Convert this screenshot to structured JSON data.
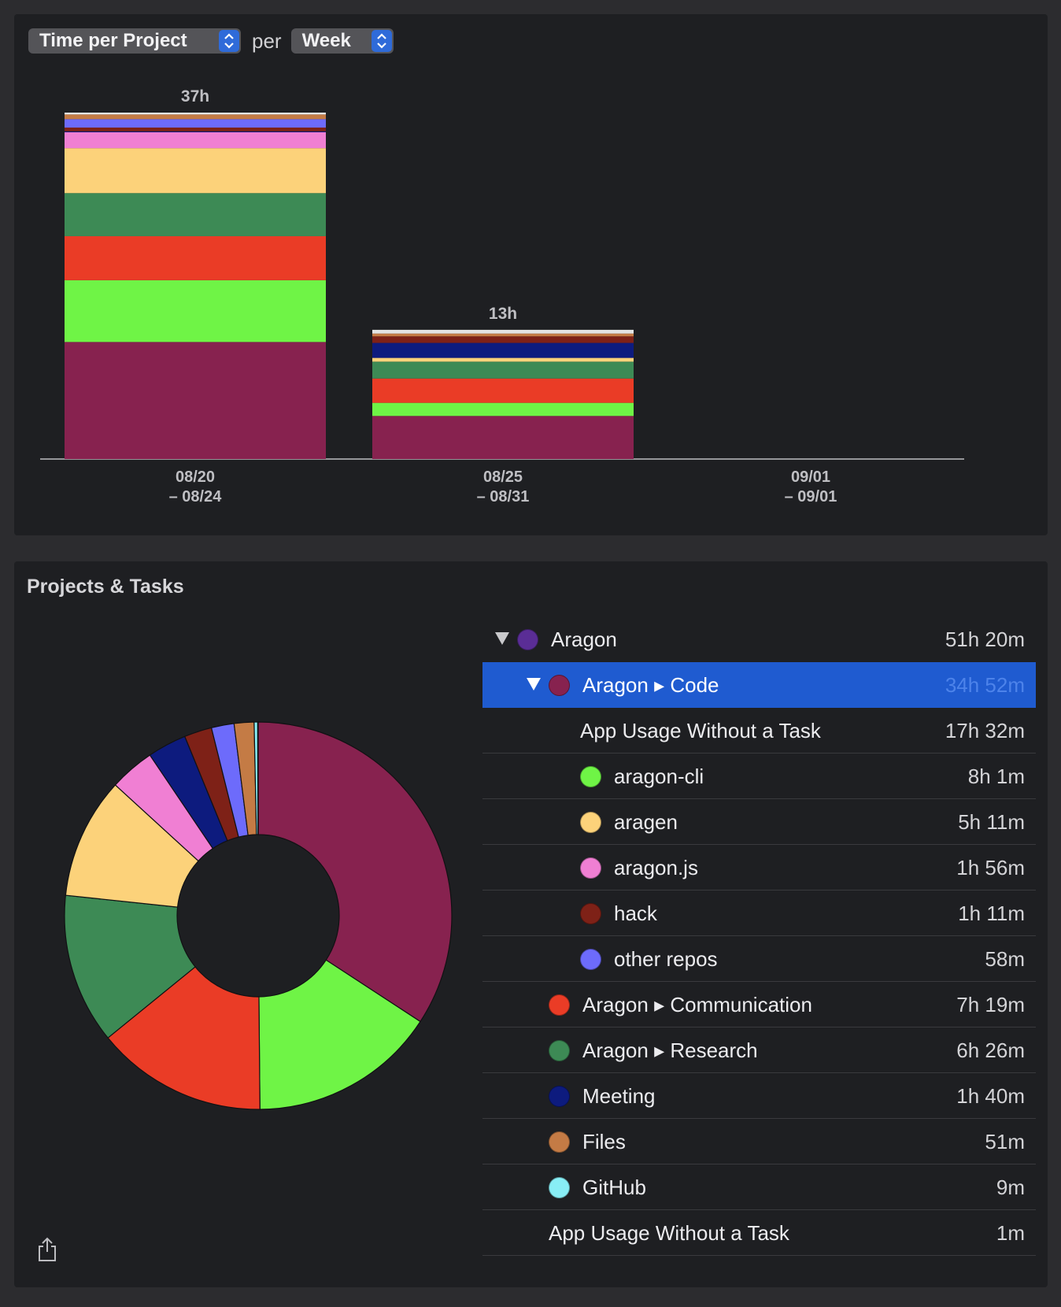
{
  "toolbar": {
    "metric_select": "Time per Project",
    "per_label": "per",
    "period_select": "Week"
  },
  "colors": {
    "code": "#87224f",
    "cli": "#6ff446",
    "communication": "#ea3c26",
    "research": "#3d8a55",
    "aragen": "#fcd27a",
    "aragonjs": "#f07fd3",
    "hack": "#7e2117",
    "other_repos": "#6d6bfb",
    "meeting": "#0d1b7e",
    "files": "#c47b45",
    "github": "#88eef5",
    "no_task": "#e4e4e4",
    "aragon": "#5a2d96"
  },
  "chart_data": [
    {
      "type": "bar",
      "stacked": true,
      "categories": [
        "08/20 – 08/24",
        "08/25 – 08/31",
        "09/01 – 09/01"
      ],
      "category_lines": [
        [
          "08/20",
          "– 08/24"
        ],
        [
          "08/25",
          "– 08/31"
        ],
        [
          "09/01",
          "– 09/01"
        ]
      ],
      "totals": [
        "37h",
        "13h",
        ""
      ],
      "total_hours": [
        37,
        13,
        0
      ],
      "unit": "hours",
      "ylim": [
        0,
        37
      ],
      "grid": false,
      "series": [
        {
          "color": "#87224f",
          "values": [
            12.5,
            4.6,
            0
          ]
        },
        {
          "color": "#6ff446",
          "values": [
            6.6,
            1.4,
            0
          ]
        },
        {
          "color": "#ea3c26",
          "values": [
            4.7,
            2.6,
            0
          ]
        },
        {
          "color": "#3d8a55",
          "values": [
            4.6,
            1.8,
            0
          ]
        },
        {
          "color": "#fcd27a",
          "values": [
            4.8,
            0.4,
            0
          ]
        },
        {
          "color": "#f07fd3",
          "values": [
            1.7,
            0.0,
            0
          ]
        },
        {
          "color": "#0d1b7e",
          "values": [
            0.1,
            1.6,
            0
          ]
        },
        {
          "color": "#7e2117",
          "values": [
            0.4,
            0.7,
            0
          ]
        },
        {
          "color": "#6d6bfb",
          "values": [
            0.9,
            0.0,
            0
          ]
        },
        {
          "color": "#c47b45",
          "values": [
            0.5,
            0.3,
            0
          ]
        },
        {
          "color": "#e4e4e4",
          "values": [
            0.2,
            0.4,
            0
          ]
        }
      ]
    },
    {
      "type": "pie",
      "donut": true,
      "unit": "hours",
      "slices": [
        {
          "color": "#87224f",
          "value": 17.53
        },
        {
          "color": "#6ff446",
          "value": 8.02
        },
        {
          "color": "#ea3c26",
          "value": 7.32
        },
        {
          "color": "#3d8a55",
          "value": 6.43
        },
        {
          "color": "#fcd27a",
          "value": 5.18
        },
        {
          "color": "#f07fd3",
          "value": 1.93
        },
        {
          "color": "#0d1b7e",
          "value": 1.67
        },
        {
          "color": "#7e2117",
          "value": 1.18
        },
        {
          "color": "#6d6bfb",
          "value": 0.97
        },
        {
          "color": "#c47b45",
          "value": 0.85
        },
        {
          "color": "#88eef5",
          "value": 0.15
        },
        {
          "color": "#e4e4e4",
          "value": 0.02
        }
      ]
    }
  ],
  "panel_title": "Projects & Tasks",
  "tree": {
    "rows": [
      {
        "label": "Aragon",
        "duration": "51h 20m",
        "color": "#5a2d96",
        "level": 0,
        "disclosure": true,
        "selected": false
      },
      {
        "label": "Aragon ▸ Code",
        "duration": "34h 52m",
        "color": "#87224f",
        "level": 1,
        "disclosure": true,
        "selected": true
      },
      {
        "label": "App Usage Without a Task",
        "duration": "17h 32m",
        "color": "",
        "level": 2,
        "disclosure": false,
        "selected": false
      },
      {
        "label": "aragon-cli",
        "duration": "8h 1m",
        "color": "#6ff446",
        "level": 2,
        "disclosure": false,
        "selected": false
      },
      {
        "label": "aragen",
        "duration": "5h 11m",
        "color": "#fcd27a",
        "level": 2,
        "disclosure": false,
        "selected": false
      },
      {
        "label": "aragon.js",
        "duration": "1h 56m",
        "color": "#f07fd3",
        "level": 2,
        "disclosure": false,
        "selected": false
      },
      {
        "label": "hack",
        "duration": "1h 11m",
        "color": "#7e2117",
        "level": 2,
        "disclosure": false,
        "selected": false
      },
      {
        "label": "other repos",
        "duration": "58m",
        "color": "#6d6bfb",
        "level": 2,
        "disclosure": false,
        "selected": false
      },
      {
        "label": "Aragon ▸ Communication",
        "duration": "7h 19m",
        "color": "#ea3c26",
        "level": 1,
        "disclosure": false,
        "selected": false
      },
      {
        "label": "Aragon ▸ Research",
        "duration": "6h 26m",
        "color": "#3d8a55",
        "level": 1,
        "disclosure": false,
        "selected": false
      },
      {
        "label": "Meeting",
        "duration": "1h 40m",
        "color": "#0d1b7e",
        "level": 1,
        "disclosure": false,
        "selected": false
      },
      {
        "label": "Files",
        "duration": "51m",
        "color": "#c47b45",
        "level": 1,
        "disclosure": false,
        "selected": false
      },
      {
        "label": "GitHub",
        "duration": "9m",
        "color": "#88eef5",
        "level": 1,
        "disclosure": false,
        "selected": false
      },
      {
        "label": "App Usage Without a Task",
        "duration": "1m",
        "color": "",
        "level": 1,
        "disclosure": false,
        "selected": false
      }
    ]
  },
  "icons": {
    "share": "share-icon",
    "stepper": "chevron-up-down-icon",
    "disclosure": "disclosure-triangle-icon"
  }
}
